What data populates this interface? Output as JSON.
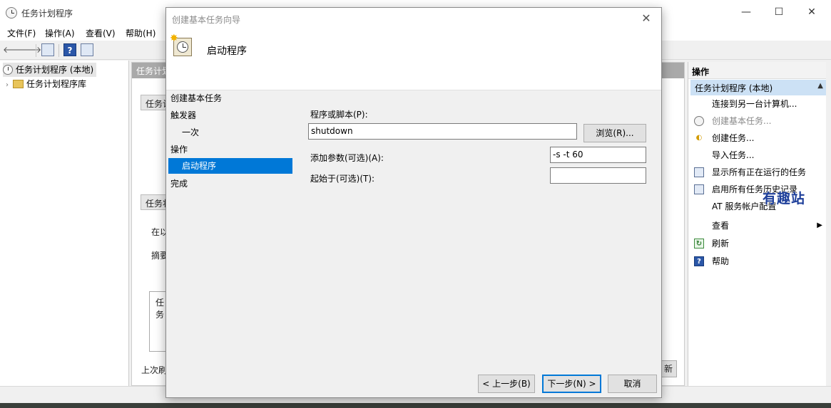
{
  "main_window": {
    "title": "任务计划程序",
    "controls": [
      "—",
      "☐",
      "✕"
    ]
  },
  "menu": [
    "文件(F)",
    "操作(A)",
    "查看(V)",
    "帮助(H)"
  ],
  "toolbar": {
    "back": "🡐",
    "forward": "🡒",
    "help": "?"
  },
  "tree": {
    "root": "任务计划程序 (本地)",
    "child": "任务计划程序库"
  },
  "center": {
    "header": "任务计划",
    "group1": "任务计",
    "group2": "任务状",
    "text1": "在以",
    "text2": "摘要",
    "text3": "任务",
    "footer_left": "上次刷",
    "footer_right_btn": "新"
  },
  "actions_pane": {
    "header": "操作",
    "selected": "任务计划程序 (本地)",
    "items": [
      {
        "label": "连接到另一台计算机...",
        "icon": "",
        "dim": false
      },
      {
        "label": "创建基本任务...",
        "icon": "clock-icon",
        "dim": true
      },
      {
        "label": "创建任务...",
        "icon": "new-task-icon",
        "dim": false
      },
      {
        "label": "导入任务...",
        "icon": "",
        "dim": false
      },
      {
        "label": "显示所有正在运行的任务",
        "icon": "grid-icon",
        "dim": false
      },
      {
        "label": "启用所有任务历史记录",
        "icon": "history-icon",
        "dim": false
      },
      {
        "label": "AT 服务帐户配置",
        "icon": "",
        "dim": false
      },
      {
        "label": "查看",
        "icon": "",
        "dim": false
      },
      {
        "label": "刷新",
        "icon": "refresh-icon",
        "dim": false
      },
      {
        "label": "帮助",
        "icon": "help-icon",
        "dim": false
      }
    ]
  },
  "watermark": "有趣站",
  "wizard": {
    "title": "创建基本任务向导",
    "heading": "启动程序",
    "steps": [
      {
        "label": "创建基本任务",
        "indent": false,
        "selected": false
      },
      {
        "label": "触发器",
        "indent": false,
        "selected": false
      },
      {
        "label": "一次",
        "indent": true,
        "selected": false
      },
      {
        "label": "操作",
        "indent": false,
        "selected": false
      },
      {
        "label": "启动程序",
        "indent": true,
        "selected": true
      },
      {
        "label": "完成",
        "indent": false,
        "selected": false
      }
    ],
    "program_label": "程序或脚本(P):",
    "program_value": "shutdown",
    "browse_button": "浏览(R)...",
    "args_label": "添加参数(可选)(A):",
    "args_value": "-s -t 60",
    "startin_label": "起始于(可选)(T):",
    "startin_value": "",
    "back_button": "< 上一步(B)",
    "next_button": "下一步(N) >",
    "cancel_button": "取消"
  }
}
